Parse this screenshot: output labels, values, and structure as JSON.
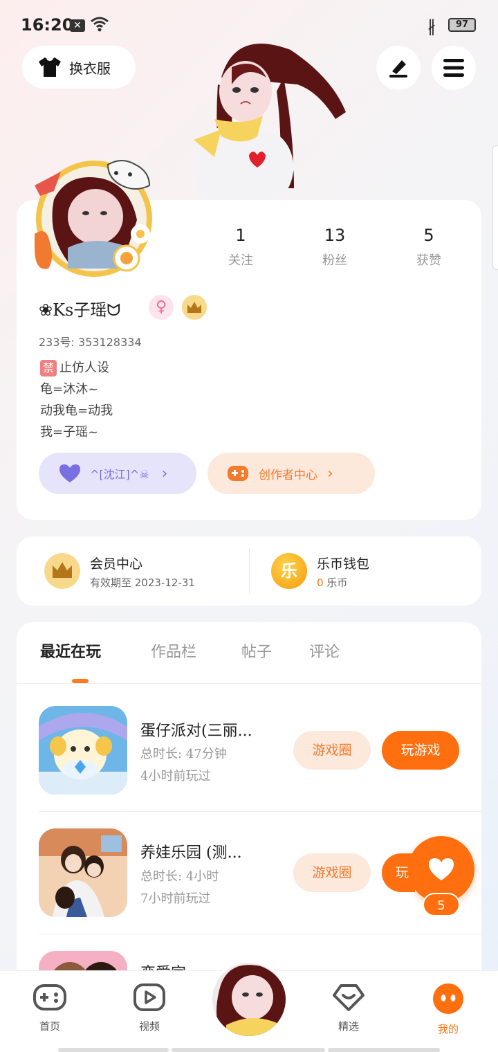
{
  "status_bar": {
    "time": "16:20",
    "battery": "97"
  },
  "header": {
    "outfit_label": "换衣服"
  },
  "profile": {
    "stats": [
      {
        "value": "1",
        "label": "关注"
      },
      {
        "value": "13",
        "label": "粉丝"
      },
      {
        "value": "5",
        "label": "获赞"
      }
    ],
    "nickname": "❀Ks子瑶ᗢ",
    "uid": "233号: 353128334",
    "bio": {
      "line1_badge": "禁",
      "line1": "止仿人设",
      "line2": "龟=沐沐~",
      "line3": "动我龟=动我",
      "line4": "我=子瑶~"
    },
    "group_chip": "^[沈江]^☠",
    "creator_chip": "创作者中心"
  },
  "member": {
    "vip_title": "会员中心",
    "vip_sub": "有效期至 2023-12-31",
    "wallet_title": "乐币钱包",
    "wallet_amount": "0",
    "wallet_unit": "乐币",
    "wallet_icon_char": "乐"
  },
  "tabs": [
    "最近在玩",
    "作品栏",
    "帖子",
    "评论"
  ],
  "games": [
    {
      "title": "蛋仔派对(三丽...",
      "playtime": "总时长: 47分钟",
      "last_played": "4小时前玩过",
      "circle_label": "游戏圈",
      "play_label": "玩游戏"
    },
    {
      "title": "养娃乐园 (测...",
      "playtime": "总时长: 4小时",
      "last_played": "7小时前玩过",
      "circle_label": "游戏圈",
      "play_label": "玩"
    },
    {
      "title": "恋爱宫..."
    }
  ],
  "like_count": "5",
  "bottom_nav": [
    {
      "label": "首页"
    },
    {
      "label": "视频"
    },
    {
      "label": "精选"
    },
    {
      "label": "我的"
    }
  ],
  "colors": {
    "accent": "#ff6f0f",
    "purple": "#7a6fe0"
  }
}
